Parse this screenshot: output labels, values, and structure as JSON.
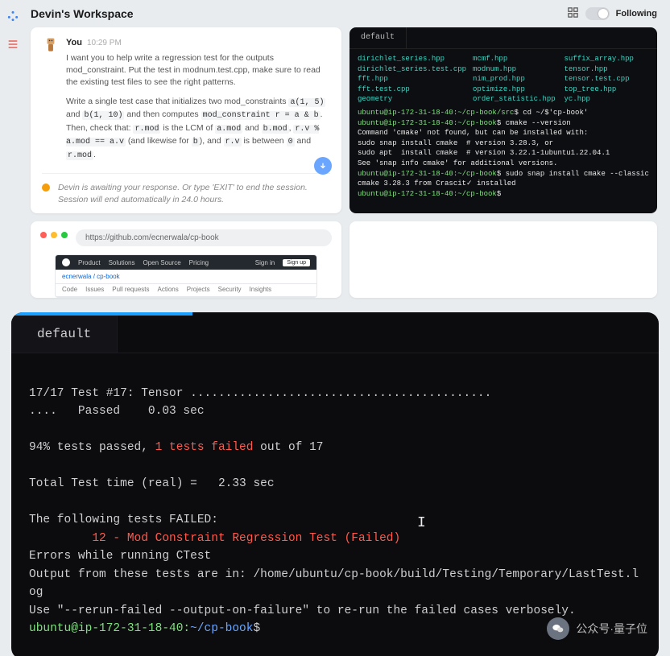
{
  "header": {
    "title": "Devin's Workspace",
    "following_label": "Following"
  },
  "chat": {
    "user": "You",
    "time": "10:29 PM",
    "p1_pre": "I want you to help write a regression test for the outputs mod_constraint.  Put the test in modnum.test.cpp, make sure to read the existing test files to see the right patterns.",
    "p2_a": "Write a single test case that initializes two mod_constraints ",
    "c1": "a(1, 5)",
    "p2_b": " and ",
    "c2": "b(1, 10)",
    "p2_c": " and then computes ",
    "c3": "mod_constraint r = a & b",
    "p2_d": ". Then, check that: ",
    "c4": "r.mod",
    "p2_e": " is the LCM of ",
    "c5": "a.mod",
    "p2_f": " and ",
    "c6": "b.mod",
    "p2_g": ", ",
    "c7": "r.v % a.mod == a.v",
    "p2_h": " (and likewise for ",
    "c8": "b",
    "p2_i": "), and ",
    "c9": "r.v",
    "p2_j": " is between ",
    "c10": "0",
    "p2_k": " and ",
    "c11": "r.mod",
    "p2_l": ".",
    "status": "Devin is awaiting your response. Or type 'EXIT' to end the session. Session will end automatically in 24.0 hours."
  },
  "term_small": {
    "tab": "default",
    "files": [
      "dirichlet_series.hpp",
      "mcmf.hpp",
      "suffix_array.hpp",
      "dirichlet_series.test.cpp",
      "modnum.hpp",
      "tensor.hpp",
      "fft.hpp",
      "nim_prod.hpp",
      "tensor.test.cpp",
      "fft.test.cpp",
      "optimize.hpp",
      "top_tree.hpp",
      "geometry",
      "order_statistic.hpp",
      "yc.hpp"
    ],
    "lines": [
      {
        "prompt": "ubuntu@ip-172-31-18-40:~/cp-book/src",
        "cmd": "$ cd ~/$'cp-book'"
      },
      {
        "prompt": "ubuntu@ip-172-31-18-40:~/cp-book",
        "cmd": "$ cmake --version"
      },
      {
        "plain": "Command 'cmake' not found, but can be installed with:"
      },
      {
        "plain": "sudo snap install cmake  # version 3.28.3, or"
      },
      {
        "plain": "sudo apt  install cmake  # version 3.22.1-1ubuntu1.22.04.1"
      },
      {
        "plain": "See 'snap info cmake' for additional versions."
      },
      {
        "prompt": "ubuntu@ip-172-31-18-40:~/cp-book",
        "cmd": "$ sudo snap install cmake --classic"
      },
      {
        "plain": "cmake 3.28.3 from Crascit✓ installed"
      },
      {
        "prompt": "ubuntu@ip-172-31-18-40:~/cp-book",
        "cmd": "$"
      }
    ]
  },
  "browser": {
    "url": "https://github.com/ecnerwala/cp-book",
    "gh_nav": [
      "Product",
      "Solutions",
      "Open Source",
      "Pricing"
    ],
    "gh_repo": "ecnerwala / cp-book",
    "gh_signin": "Sign in",
    "gh_signup": "Sign up",
    "gh_tabs": [
      "Code",
      "Issues",
      "Pull requests",
      "Actions",
      "Projects",
      "Security",
      "Insights"
    ]
  },
  "term_big": {
    "tab": "default",
    "l1": "17/17 Test #17: Tensor ...........................................",
    "l2": "....   Passed    0.03 sec",
    "l3a": "94% tests passed, ",
    "l3b": "1 tests failed",
    "l3c": " out of 17",
    "l4": "Total Test time (real) =   2.33 sec",
    "l5": "The following tests FAILED:",
    "l6": "         12 - Mod Constraint Regression Test (Failed)",
    "l7": "Errors while running CTest",
    "l8": "Output from these tests are in: /home/ubuntu/cp-book/build/Testing/Temporary/LastTest.log",
    "l9": "Use \"--rerun-failed --output-on-failure\" to re-run the failed cases verbosely.",
    "prompt": "ubuntu@ip-172-31-18-40:",
    "path": "~/cp-book",
    "dollar": "$"
  },
  "wm": {
    "text": "公众号·量子位"
  }
}
